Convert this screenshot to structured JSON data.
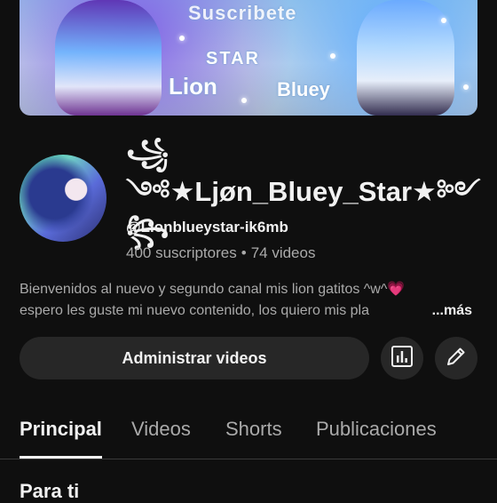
{
  "banner": {
    "title_top": "Suscribete",
    "title_mid": "STAR",
    "title_left": "Lion",
    "title_right": "Bluey"
  },
  "channel": {
    "name": "꧁༺★Ljøn_Bluey_Star★༻꧂",
    "handle": "@Lionblueystar-ik6mb",
    "subscribers": "400 suscriptores",
    "separator": "•",
    "videos_count": "74 videos"
  },
  "description": {
    "line1": "Bienvenidos al nuevo y segundo canal mis lion gatitos ^w^",
    "emoji": "💗",
    "line2": "espero les guste mi nuevo contenido, los quiero mis pla",
    "more": "...más"
  },
  "actions": {
    "manage_label": "Administrar videos",
    "stats_icon": "bar-chart-icon",
    "edit_icon": "pencil-icon"
  },
  "tabs": [
    {
      "label": "Principal",
      "active": true
    },
    {
      "label": "Videos",
      "active": false
    },
    {
      "label": "Shorts",
      "active": false
    },
    {
      "label": "Publicaciones",
      "active": false
    }
  ],
  "section": {
    "title": "Para ti"
  },
  "colors": {
    "background": "#0f0f0f",
    "button_bg": "#272727",
    "text_primary": "#f1f1f1",
    "text_secondary": "#aaaaaa",
    "heart": "#ff3f9a"
  }
}
